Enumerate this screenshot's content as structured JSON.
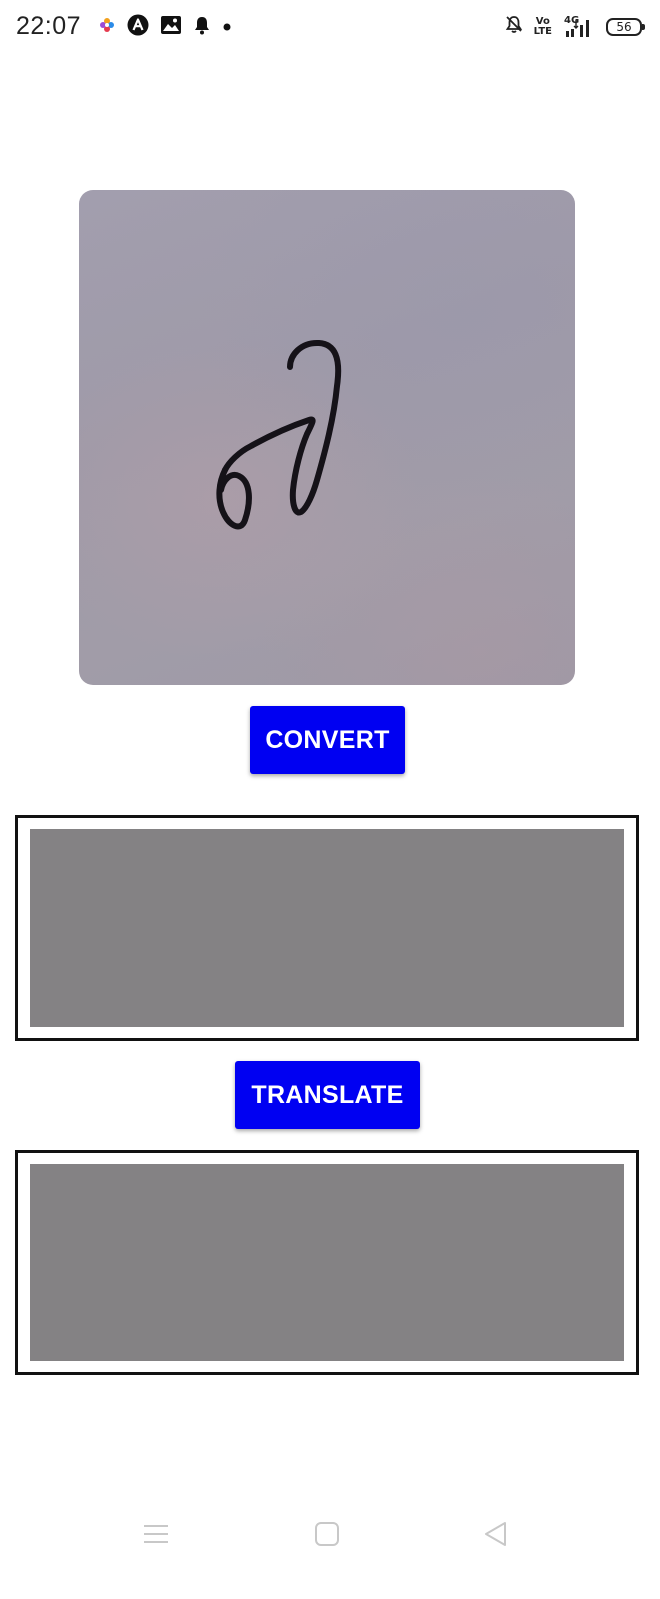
{
  "status_bar": {
    "time": "22:07",
    "left_icons": [
      "pinwheel-app-icon",
      "a-circle-app-icon",
      "gallery-app-icon",
      "bell-notification-icon",
      "more-notifications-dot-icon"
    ],
    "right_icons": [
      "bell-muted-icon",
      "volte-icon",
      "signal-4g-icon",
      "battery-icon"
    ],
    "network_top": "Vo",
    "network_bottom": "LTE",
    "network_type": "4G",
    "battery_level": "56"
  },
  "main": {
    "image": {
      "description_icon": "handwritten-character-image"
    },
    "convert_button_label": "CONVERT",
    "converted_output_value": "",
    "translate_button_label": "TRANSLATE",
    "translated_output_value": ""
  },
  "nav_bar": {
    "icons": [
      "menu-icon",
      "home-icon",
      "back-icon"
    ]
  },
  "colors": {
    "button_bg": "#0000f2",
    "button_text": "#ffffff",
    "output_fill": "#848284",
    "output_border": "#111111",
    "image_bg": "#a09ca9"
  }
}
